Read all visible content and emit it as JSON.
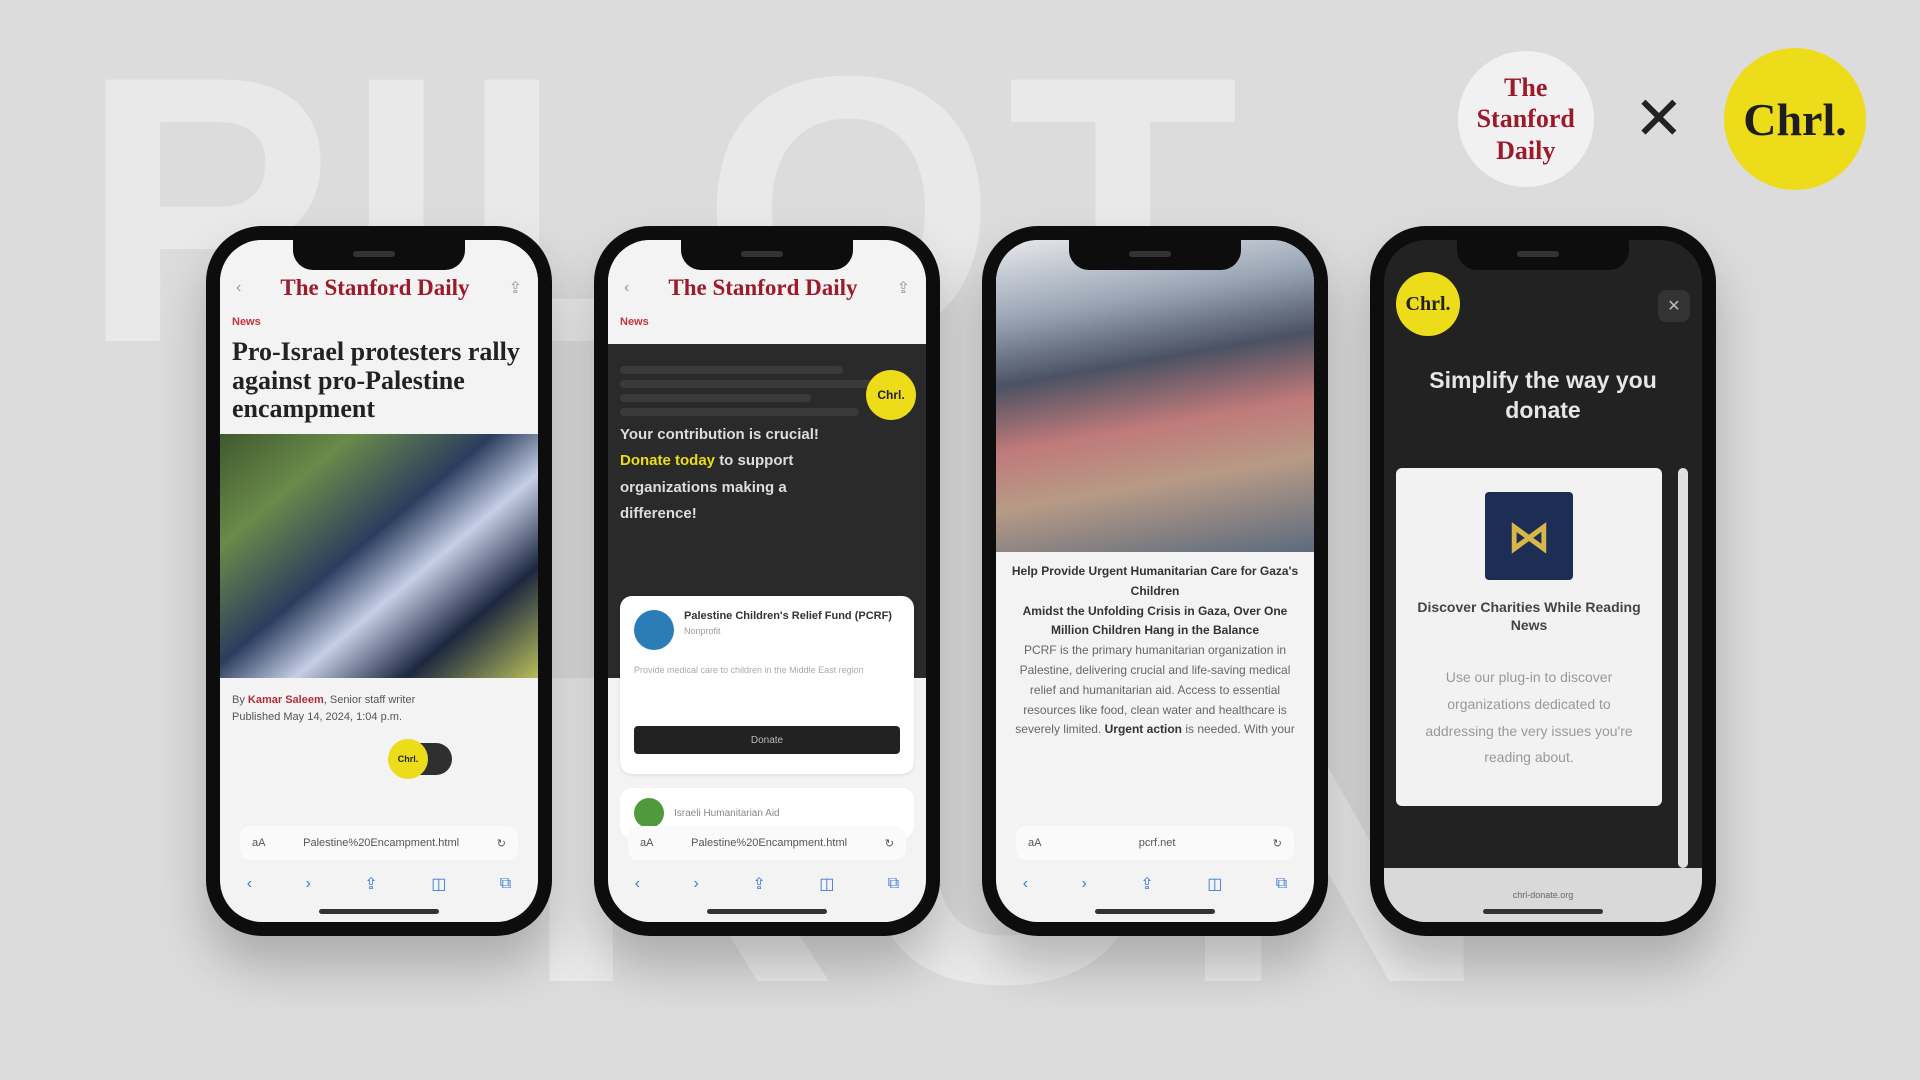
{
  "background": {
    "word_top": "PILOT",
    "word_bottom": "RUN"
  },
  "logos": {
    "partner_name": "The Stanford Daily",
    "separator": "✕",
    "brand": "Chrl."
  },
  "colors": {
    "accent_yellow": "#ecdc1a",
    "stanford_red": "#9c1b2b",
    "link_blue": "#3a7bd5"
  },
  "phone1": {
    "masthead": "The Stanford Daily",
    "kicker": "News",
    "headline": "Pro-Israel protesters rally against pro-Palestine encampment",
    "byline_author": "Kamar Saleem",
    "byline_suffix": "Senior staff writer",
    "byline_date": "Published May 14, 2024, 1:04 p.m.",
    "pill_badge": "Chrl.",
    "url": "Palestine%20Encampment.html",
    "toolbar": [
      "‹",
      "›",
      "⇪",
      "◫",
      "⧉"
    ]
  },
  "phone2": {
    "masthead": "The Stanford Daily",
    "kicker": "News",
    "badge": "Chrl.",
    "message_prefix": "Your contribution is crucial!",
    "message_link": "Donate today",
    "message_suffix": "to support organizations making a difference!",
    "card1_name": "Palestine Children's Relief Fund (PCRF)",
    "card1_sub": "Nonprofit",
    "card1_desc": "Provide medical care to children in the Middle East region",
    "card1_button": "Donate",
    "card2_name": "Israeli Humanitarian Aid",
    "url": "Palestine%20Encampment.html",
    "toolbar": [
      "‹",
      "›",
      "⇪",
      "◫",
      "⧉"
    ]
  },
  "phone3": {
    "title": "Help Provide Urgent Humanitarian Care for Gaza's Children",
    "subtitle": "Amidst the Unfolding Crisis in Gaza, Over One Million Children Hang in the Balance",
    "body": "PCRF is the primary humanitarian organization in Palestine, delivering crucial and life-saving medical relief and humanitarian aid. Access to essential resources like food, clean water and healthcare is severely limited.",
    "body_bold": "Urgent action",
    "body_end": "is needed. With your",
    "url": "pcrf.net",
    "text_size": "aA",
    "toolbar": [
      "‹",
      "›",
      "⇪",
      "◫",
      "⧉"
    ]
  },
  "phone4": {
    "badge": "Chrl.",
    "close": "✕",
    "pitch": "Simplify the way you donate",
    "feature_title": "Discover Charities While Reading News",
    "feature_desc": "Use our plug-in to discover organizations dedicated to addressing the very issues you're reading about.",
    "bottom_url": "chrl-donate.org"
  }
}
